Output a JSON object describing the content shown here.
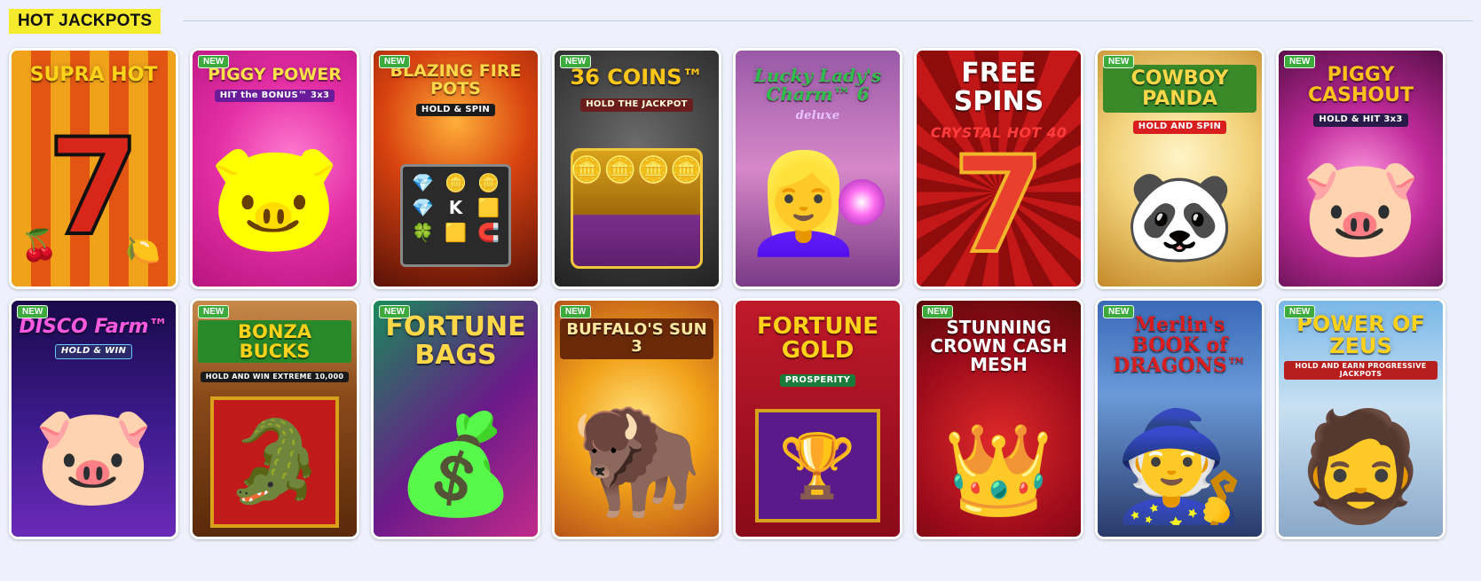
{
  "section": {
    "title": "HOT JACKPOTS"
  },
  "colors": {
    "title_bg": "#f6ea2c",
    "page_bg": "#eef1fb",
    "new_badge": "#3daa3d"
  },
  "games": [
    {
      "title": "SUPRA HOT",
      "subtitle": "",
      "badge": "",
      "icon": "lucky-seven-icon"
    },
    {
      "title": "PIGGY POWER",
      "subtitle": "HIT the BONUS™ 3x3",
      "badge": "NEW",
      "icon": "piggy-bank-icon"
    },
    {
      "title": "BLAZING FIRE POTS",
      "subtitle": "HOLD & SPIN",
      "badge": "NEW",
      "icon": "slot-reels-icon"
    },
    {
      "title": "36 COINS™",
      "subtitle": "HOLD THE JACKPOT",
      "badge": "NEW",
      "icon": "treasure-chest-icon"
    },
    {
      "title": "Lucky Lady's Charm™ 6",
      "subtitle": "deluxe",
      "badge": "",
      "icon": "crystal-ball-icon"
    },
    {
      "title": "FREE SPINS",
      "subtitle": "CRYSTAL HOT 40",
      "badge": "",
      "icon": "lucky-seven-icon"
    },
    {
      "title": "COWBOY PANDA",
      "subtitle": "HOLD AND SPIN",
      "badge": "NEW",
      "icon": "panda-icon"
    },
    {
      "title": "PIGGY CASHOUT",
      "subtitle": "HOLD & HIT 3x3",
      "badge": "NEW",
      "icon": "pig-icon"
    },
    {
      "title": "DISCO Farm™",
      "subtitle": "HOLD & WIN",
      "badge": "NEW",
      "icon": "disco-pig-icon"
    },
    {
      "title": "BONZA BUCKS",
      "subtitle": "HOLD AND WIN EXTREME 10,000",
      "badge": "NEW",
      "icon": "crocodile-icon"
    },
    {
      "title": "FORTUNE BAGS",
      "subtitle": "",
      "badge": "NEW",
      "icon": "money-bag-icon"
    },
    {
      "title": "BUFFALO'S SUN 3",
      "subtitle": "",
      "badge": "NEW",
      "icon": "buffalo-icon"
    },
    {
      "title": "FORTUNE GOLD",
      "subtitle": "PROSPERITY",
      "badge": "",
      "icon": "gold-ingot-icon"
    },
    {
      "title": "STUNNING CROWN CASH MESH",
      "subtitle": "",
      "badge": "NEW",
      "icon": "crown-icon"
    },
    {
      "title": "Merlin's BOOK of DRAGONS™",
      "subtitle": "",
      "badge": "NEW",
      "icon": "wizard-icon"
    },
    {
      "title": "POWER OF ZEUS",
      "subtitle": "HOLD AND EARN PROGRESSIVE JACKPOTS",
      "badge": "NEW",
      "icon": "zeus-icon"
    }
  ]
}
